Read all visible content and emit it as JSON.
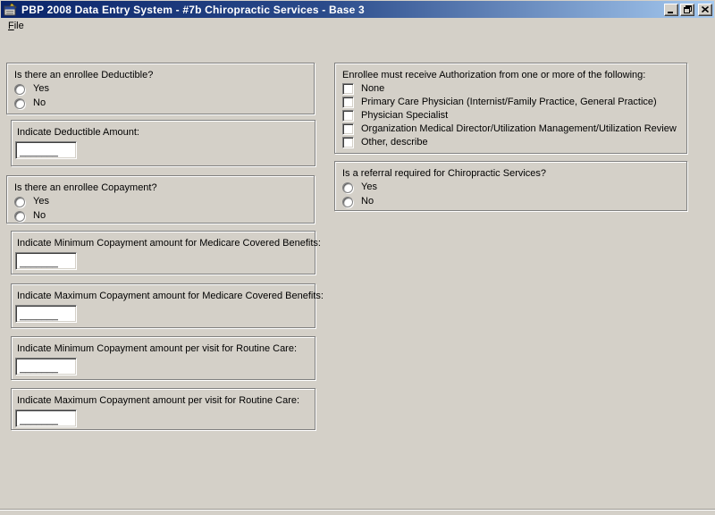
{
  "window": {
    "title": "PBP 2008 Data Entry System - #7b Chiropractic Services - Base 3"
  },
  "menu": {
    "file_accel": "F",
    "file_rest": "ile"
  },
  "fields": {
    "blank": "_______"
  },
  "left": {
    "deductible_q": {
      "title": "Is there an enrollee Deductible?",
      "yes": "Yes",
      "no": "No"
    },
    "deductible_amt": {
      "title": "Indicate Deductible Amount:"
    },
    "copay_q": {
      "title": "Is there an enrollee Copayment?",
      "yes": "Yes",
      "no": "No"
    },
    "min_copay_medicare": {
      "title": "Indicate Minimum Copayment amount for Medicare Covered Benefits:"
    },
    "max_copay_medicare": {
      "title": "Indicate Maximum Copayment amount for Medicare Covered Benefits:"
    },
    "min_copay_routine": {
      "title": "Indicate Minimum Copayment amount per visit for Routine Care:"
    },
    "max_copay_routine": {
      "title": "Indicate Maximum Copayment amount per visit for Routine Care:"
    }
  },
  "right": {
    "authorization": {
      "title": "Enrollee must receive Authorization from one or more of the following:",
      "options": [
        "None",
        "Primary Care Physician (Internist/Family Practice, General Practice)",
        "Physician Specialist",
        "Organization Medical Director/Utilization Management/Utilization Review",
        "Other, describe"
      ]
    },
    "referral_q": {
      "title": "Is a referral required for Chiropractic Services?",
      "yes": "Yes",
      "no": "No"
    }
  },
  "colors": {
    "titlebar_left": "#0a246a",
    "titlebar_right": "#a6caf0",
    "chrome": "#d4d0c8"
  }
}
